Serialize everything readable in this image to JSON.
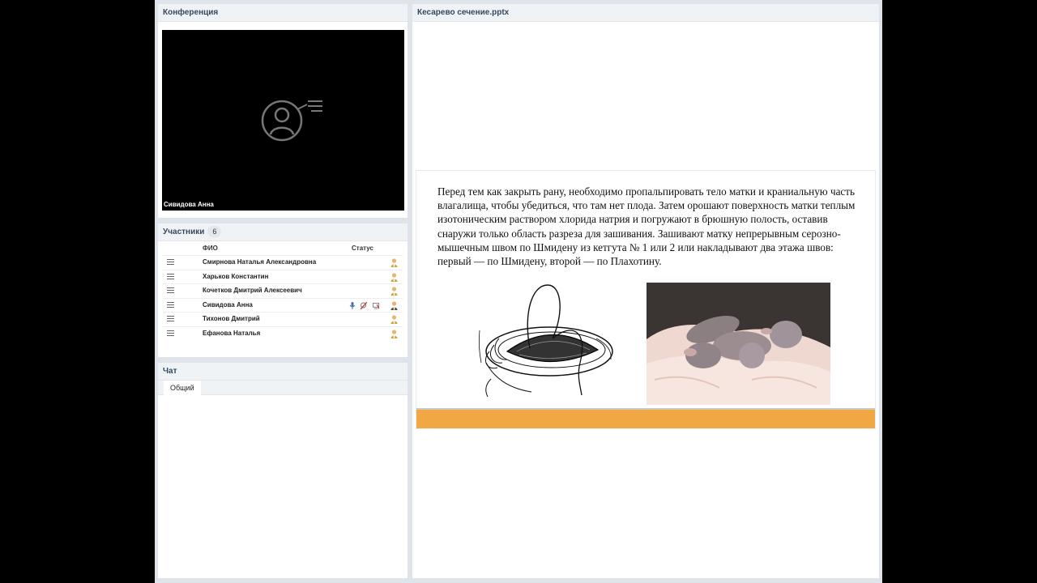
{
  "conference": {
    "title": "Конференция",
    "video_name": "Сивидова Анна"
  },
  "participants": {
    "title": "Участники",
    "count": "6",
    "col_name": "ФИО",
    "col_status": "Статус",
    "list": [
      {
        "name": "Смирнова Наталья  Александровна",
        "active": false
      },
      {
        "name": "Харьков Константин",
        "active": false
      },
      {
        "name": "Кочетков  Дмитрий  Алексеевич",
        "active": false
      },
      {
        "name": "Сивидова Анна",
        "active": true
      },
      {
        "name": "Тихонов Дмитрий",
        "active": false
      },
      {
        "name": "Ефанова Наталья",
        "active": false
      }
    ]
  },
  "chat": {
    "title": "Чат",
    "tab": "Общий"
  },
  "presentation": {
    "title": "Кесарево сечение.pptx",
    "slide_text": "Перед тем как закрыть рану, необходимо пропальпировать тело матки и краниальную часть влагалища, чтобы убедиться, что там нет плода. Затем орошают поверхность матки теплым изотоническим раствором хлорида натрия и погружают в брюшную полость, оставив снаружи только область разреза для зашивания. Зашивают матку непрерывным серозно-мышечным швом по Шмидену из кетгута № 1 или 2 или накладывают два этажа швов: первый — по Шмидену, второй — по Плахотину.",
    "accent": "#f2a745"
  }
}
